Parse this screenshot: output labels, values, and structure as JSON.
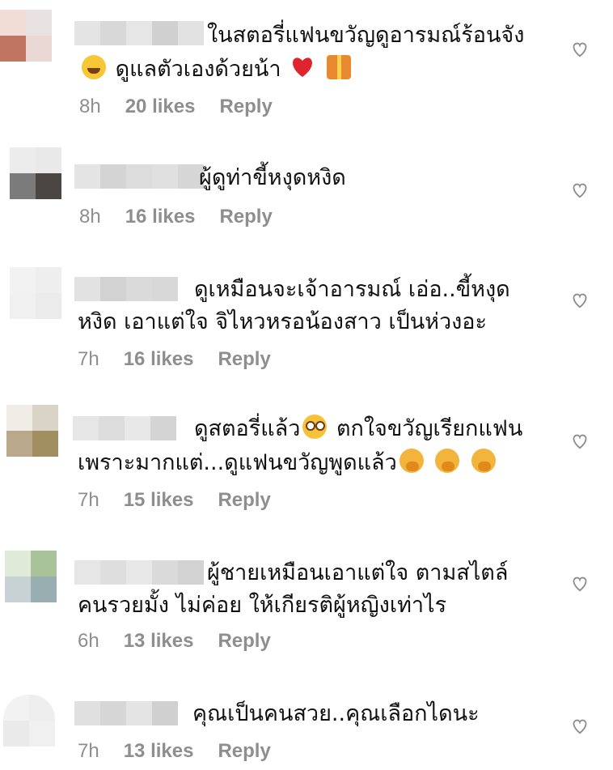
{
  "comments": [
    {
      "text_lines": [
        "ในสตอรี่แฟนขวัญดูอารมณ์ร้อนจัง",
        "ดูแลตัวเองด้วยน้า"
      ],
      "time": "8h",
      "likes": "20 likes",
      "reply": "Reply",
      "emojis": [
        "smiling-face-with-sweat-emoji",
        "red-heart-emoji",
        "wrapped-gift-emoji"
      ]
    },
    {
      "text_lines": [
        "ผู้ดูท่าขี้หงุดหงิด"
      ],
      "time": "8h",
      "likes": "16 likes",
      "reply": "Reply"
    },
    {
      "text_lines": [
        "ดูเหมือนจะเจ้าอารมณ์ เอ่อ..ขี้หงุด",
        "หงิด  เอาแต่ใจ จิไหวหรอน้องสาว เป็นห่วงอะ"
      ],
      "time": "7h",
      "likes": "16 likes",
      "reply": "Reply"
    },
    {
      "text_lines": [
        "ดูสตอรี่แล้ว",
        "ตกใจขวัญเรียกแฟน",
        "เพราะมากแต่...ดูแฟนขวัญพูดแล้ว"
      ],
      "time": "7h",
      "likes": "15 likes",
      "reply": "Reply",
      "emojis": [
        "flushed-face-emoji",
        "face-with-hand-over-mouth-emoji"
      ]
    },
    {
      "text_lines": [
        "ผู้ชายเหมือนเอาแต่ใจ ตามสไตล์",
        "คนรวยมั้ง ไม่ค่อย ให้เกียรติผู้หญิงเท่าไร"
      ],
      "time": "6h",
      "likes": "13 likes",
      "reply": "Reply"
    },
    {
      "text_lines": [
        "คุณเป็นคนสวย..คุณเลือกไดนะ"
      ],
      "time": "7h",
      "likes": "13 likes",
      "reply": "Reply"
    }
  ],
  "colors": {
    "meta": "#8e8e8e",
    "heart": "#8e8e8e",
    "text": "#111111"
  }
}
